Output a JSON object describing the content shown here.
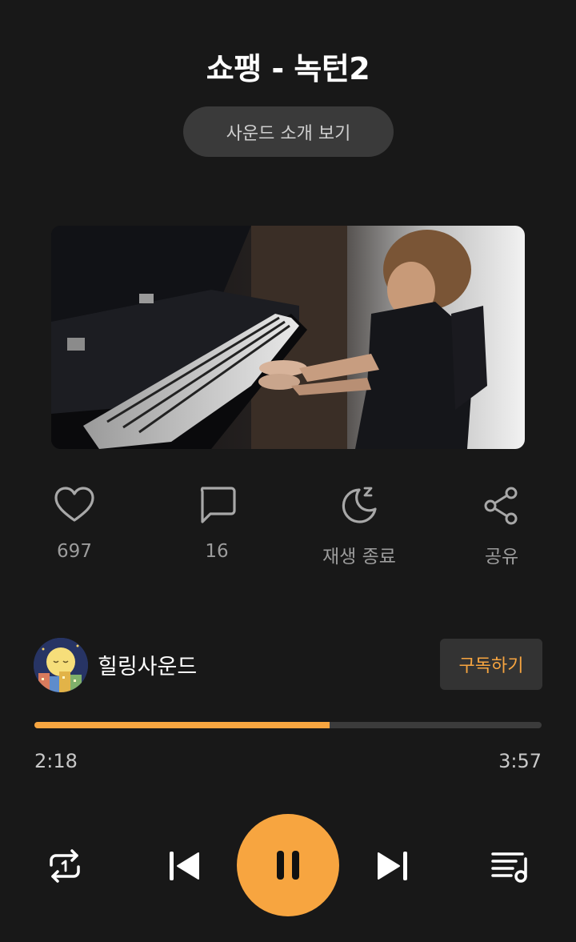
{
  "header": {
    "title": "쇼팽 - 녹턴2",
    "intro_button": "사운드 소개 보기"
  },
  "actions": [
    {
      "icon": "heart-icon",
      "label": "697"
    },
    {
      "icon": "comment-icon",
      "label": "16"
    },
    {
      "icon": "sleep-timer-icon",
      "label": "재생 종료"
    },
    {
      "icon": "share-icon",
      "label": "공유"
    }
  ],
  "channel": {
    "name": "힐링사운드",
    "subscribe_label": "구독하기"
  },
  "player": {
    "current_time": "2:18",
    "total_time": "3:57",
    "progress_fraction": 0.582
  },
  "controls": {
    "repeat_icon": "repeat-one-icon",
    "prev_icon": "skip-previous-icon",
    "play_state_icon": "pause-icon",
    "next_icon": "skip-next-icon",
    "playlist_icon": "playlist-icon"
  },
  "colors": {
    "accent": "#f7a540",
    "background": "#181818"
  }
}
